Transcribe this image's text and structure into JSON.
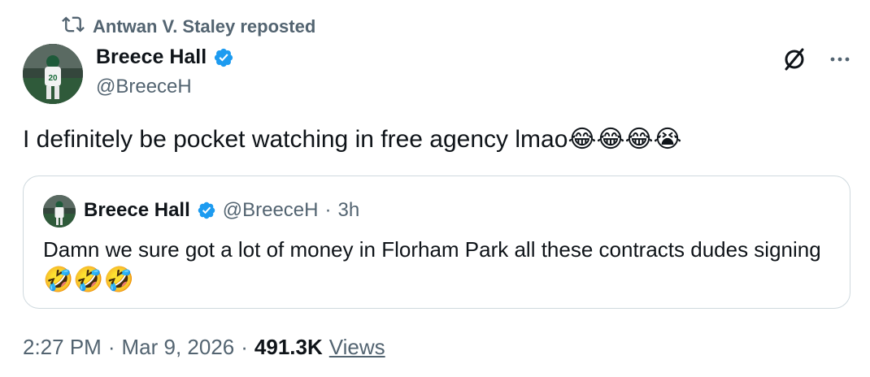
{
  "repost": {
    "text": "Antwan V. Staley reposted",
    "icon": "repost-icon"
  },
  "author": {
    "display_name": "Breece Hall",
    "handle": "@BreeceH",
    "verified": true,
    "avatar": "player-avatar"
  },
  "actions": {
    "grok_icon": "grok-icon",
    "more_icon": "more-icon"
  },
  "tweet": {
    "text": "I definitely be pocket watching in free agency lmao",
    "emojis": "😂😂😂😭"
  },
  "quote": {
    "display_name": "Breece Hall",
    "handle": "@BreeceH",
    "separator": "·",
    "time": "3h",
    "text": "Damn we sure got a lot of money in Florham Park all these contracts dudes signing",
    "emojis": "🤣🤣🤣"
  },
  "meta": {
    "time": "2:27 PM",
    "sep1": "·",
    "date": "Mar 9, 2026",
    "sep2": "·",
    "views_count": "491.3K",
    "views_label": "Views"
  },
  "colors": {
    "text": "#0f1419",
    "secondary": "#536471",
    "verified": "#1d9bf0",
    "border": "#cfd9de"
  }
}
